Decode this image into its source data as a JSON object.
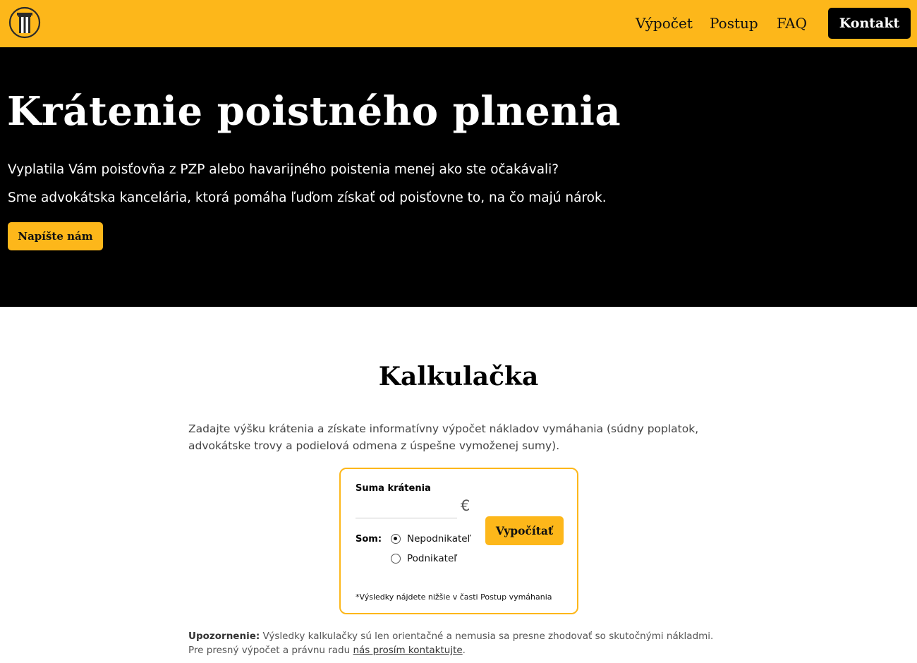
{
  "colors": {
    "accent": "#fdb71a",
    "hero_bg": "#000000"
  },
  "header": {
    "logo_icon": "greek-column-icon",
    "nav": [
      "Výpočet",
      "Postup",
      "FAQ"
    ],
    "contact_label": "Kontakt"
  },
  "hero": {
    "title": "Krátenie poistného plnenia",
    "line1": "Vyplatila Vám poisťovňa z PZP alebo havarijného poistenia menej ako ste očakávali?",
    "line2": "Sme advokátska kancelária, ktorá pomáha ľuďom získať od poisťovne to, na čo majú nárok.",
    "cta_label": "Napíšte nám"
  },
  "calculator": {
    "title": "Kalkulačka",
    "description": "Zadajte výšku krátenia a získate informatívny výpočet nákladov vymáhania (súdny poplatok, advokátske trovy a podielová odmena z úspešne vymoženej sumy).",
    "amount_label": "Suma krátenia",
    "amount_value": "",
    "currency": "€",
    "som_label": "Som:",
    "options": [
      {
        "label": "Nepodnikateľ",
        "checked": true
      },
      {
        "label": "Podnikateľ",
        "checked": false
      }
    ],
    "submit_label": "Vypočítať",
    "note": "*Výsledky nájdete nižšie v časti Postup vymáhania"
  },
  "warning": {
    "bold": "Upozornenie:",
    "text1": " Výsledky kalkulačky sú len orientačné a nemusia sa presne zhodovať so skutočnými nákladmi.",
    "text2": "Pre presný výpočet a právnu radu ",
    "link": "nás prosím kontaktujte",
    "end": "."
  }
}
